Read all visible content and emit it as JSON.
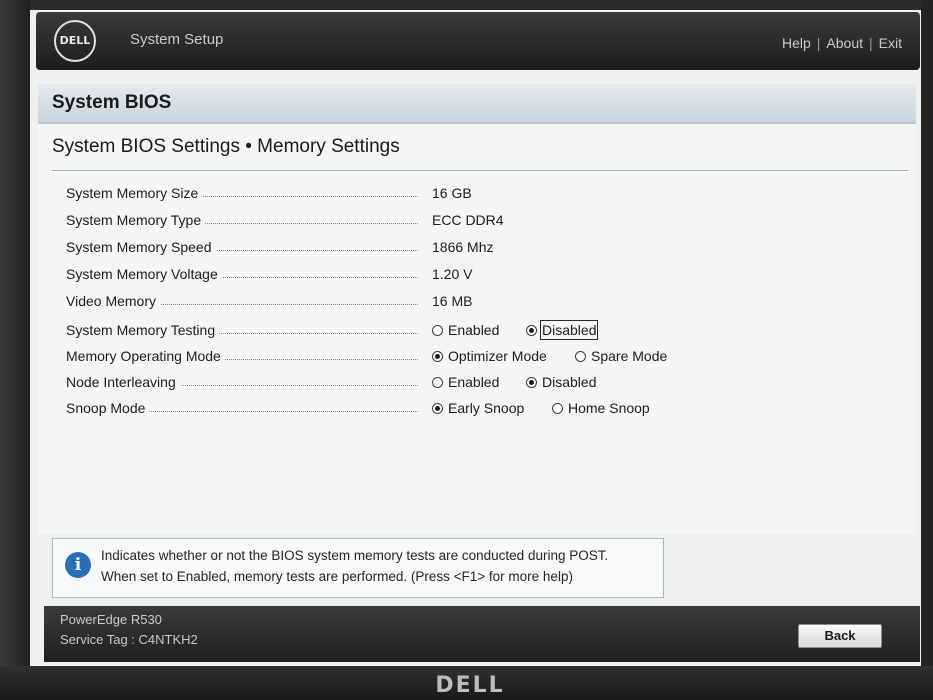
{
  "header": {
    "logo_text": "DELL",
    "app_title": "System Setup",
    "links": [
      "Help",
      "About",
      "Exit"
    ]
  },
  "section": {
    "title": "System BIOS"
  },
  "content": {
    "title": "System BIOS Settings • Memory Settings",
    "rows": [
      {
        "label": "System Memory Size",
        "value": "16 GB"
      },
      {
        "label": "System Memory Type",
        "value": "ECC DDR4"
      },
      {
        "label": "System Memory Speed",
        "value": "1866 Mhz"
      },
      {
        "label": "System Memory Voltage",
        "value": "1.20 V"
      },
      {
        "label": "Video Memory",
        "value": "16 MB"
      },
      {
        "label": "System Memory Testing",
        "options": [
          "Enabled",
          "Disabled"
        ],
        "selected": "Disabled"
      },
      {
        "label": "Memory Operating Mode",
        "options": [
          "Optimizer Mode",
          "Spare Mode"
        ],
        "selected": "Optimizer Mode"
      },
      {
        "label": "Node Interleaving",
        "options": [
          "Enabled",
          "Disabled"
        ],
        "selected": "Disabled"
      },
      {
        "label": "Snoop Mode",
        "options": [
          "Early Snoop",
          "Home Snoop"
        ],
        "selected": "Early Snoop"
      }
    ]
  },
  "help": {
    "line1": "Indicates whether or not the BIOS system memory tests are conducted during POST.",
    "line2": "When set to Enabled, memory tests are performed. (Press <F1> for more help)"
  },
  "footer": {
    "model": "PowerEdge R530",
    "service_tag": "Service Tag : C4NTKH2",
    "back_label": "Back"
  },
  "bezel": {
    "logo": "DELL"
  }
}
